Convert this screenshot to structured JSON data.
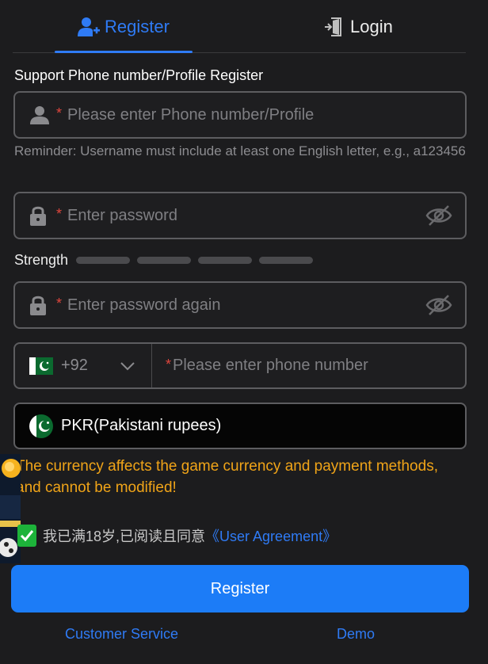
{
  "tabs": {
    "register_label": "Register",
    "login_label": "Login"
  },
  "form": {
    "section_label": "Support Phone number/Profile Register",
    "required_mark": "*",
    "username_placeholder": "Please enter Phone number/Profile",
    "reminder": "Reminder: Username must include at least one English letter, e.g., a123456",
    "password_placeholder": "Enter password",
    "strength_label": "Strength",
    "strength_level": 0,
    "confirm_placeholder": "Enter password again",
    "country_code": "+92",
    "phone_placeholder": "Please enter phone number",
    "currency_label": "PKR(Pakistani rupees)",
    "currency_warning": "The currency affects the game currency and payment methods, and cannot be modified!",
    "agree_checked": true,
    "agree_text": "我已满18岁,已阅读且同意",
    "agree_link": "《User Agreement》",
    "register_button": "Register"
  },
  "footer": {
    "customer_service": "Customer Service",
    "demo": "Demo"
  },
  "colors": {
    "accent": "#2f7bf5",
    "button": "#1c7cf7",
    "warning": "#f0a418",
    "required": "#e0463d",
    "checkbox": "#1db33a"
  },
  "icons": {
    "register_tab": "user-plus-icon",
    "login_tab": "door-login-icon",
    "username": "user-icon",
    "password": "lock-icon",
    "visibility": "eye-off-icon",
    "country": "pakistan-flag-icon",
    "dropdown": "chevron-down-icon",
    "check": "checkmark-icon"
  }
}
